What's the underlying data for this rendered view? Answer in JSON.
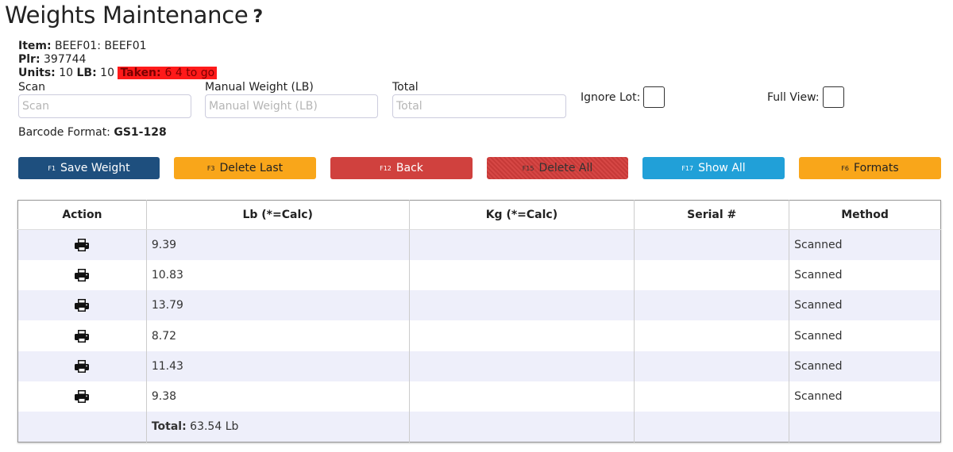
{
  "page": {
    "title": "Weights Maintenance",
    "help_symbol": "?"
  },
  "info": {
    "item_label": "Item:",
    "item_value": "BEEF01: BEEF01",
    "plr_label": "Plr:",
    "plr_value": "397744",
    "units_label": "Units:",
    "units_value": "10",
    "lb_label": "LB:",
    "lb_value": "10",
    "taken_label": "Taken:",
    "taken_value": "6  4 to go"
  },
  "inputs": {
    "scan": {
      "label": "Scan",
      "placeholder": "Scan",
      "value": ""
    },
    "manual": {
      "label": "Manual Weight (LB)",
      "placeholder": "Manual Weight (LB)",
      "value": ""
    },
    "total": {
      "label": "Total",
      "placeholder": "Total",
      "value": ""
    }
  },
  "toggles": {
    "ignore_lot": "Ignore Lot:",
    "full_view": "Full View:"
  },
  "barcode": {
    "label": "Barcode Format:",
    "value": "GS1-128"
  },
  "buttons": [
    {
      "key": "F1",
      "label": "Save Weight"
    },
    {
      "key": "F3",
      "label": "Delete Last"
    },
    {
      "key": "F12",
      "label": "Back"
    },
    {
      "key": "F15",
      "label": "Delete All"
    },
    {
      "key": "F17",
      "label": "Show All"
    },
    {
      "key": "F6",
      "label": "Formats"
    }
  ],
  "table": {
    "headers": [
      "Action",
      "Lb (*=Calc)",
      "Kg (*=Calc)",
      "Serial #",
      "Method"
    ],
    "rows": [
      {
        "lb": "9.39",
        "kg": "",
        "serial": "",
        "method": "Scanned"
      },
      {
        "lb": "10.83",
        "kg": "",
        "serial": "",
        "method": "Scanned"
      },
      {
        "lb": "13.79",
        "kg": "",
        "serial": "",
        "method": "Scanned"
      },
      {
        "lb": "8.72",
        "kg": "",
        "serial": "",
        "method": "Scanned"
      },
      {
        "lb": "11.43",
        "kg": "",
        "serial": "",
        "method": "Scanned"
      },
      {
        "lb": "9.38",
        "kg": "",
        "serial": "",
        "method": "Scanned"
      }
    ],
    "total_label": "Total:",
    "total_value": "63.54 Lb"
  },
  "colors": {
    "navy": "#1e4f7e",
    "orange": "#f9a61a",
    "red": "#d0413e",
    "blue": "#21a0d8",
    "taken_bg": "#ff1a1a",
    "row_stripe": "#eeeffa"
  },
  "icons": {
    "row_action": "print-icon"
  }
}
